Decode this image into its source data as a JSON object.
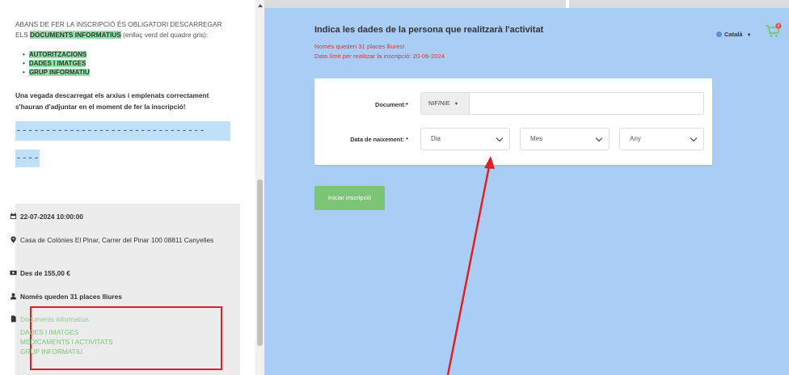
{
  "left_panel": {
    "intro_text_1": "ABANS DE FER LA INSCRIPCIÓ ÉS OBLIGATORI DESCARREGAR ELS ",
    "intro_highlight": "DOCUMENTS INFORMATIUS",
    "intro_text_2": " (enllaç verd del quadre gris):",
    "bullets": [
      "AUTORITZACIONS",
      "DADES I IMATGES",
      "GRUP INFORMATIU"
    ],
    "note": "Una vegada descarregat els arxius i emplenats correctament s'hauran d'adjuntar en el moment de fer la inscripció!",
    "dashes_line_1": "--------------------------------",
    "dashes_line_2": "----",
    "info": {
      "date": "22-07-2024 10:00:00",
      "location": "Casa de Colònies El Pinar, Carrer del Pinar 100 08811 Canyelles",
      "price": "Des de 155,00 €",
      "places": "Només queden 31 places lliures",
      "documents_title": "Documents informatius",
      "documents": [
        "DADES I IMATGES",
        "MEDICAMENTS I ACTIVITATS",
        "GRUP INFORMATIU"
      ]
    }
  },
  "main": {
    "heading": "Indica les dades de la persona que realitzarà l'activitat",
    "places_notice": "Només queden 31 places lliures!",
    "deadline_notice": "Data límit per realitzar la inscripció: 20-06-2024",
    "language": "Català",
    "cart_count": "0",
    "form": {
      "document_label": "Document:*",
      "document_type": "NIF/NIE",
      "document_value": "",
      "birth_label": "Data de naixement: *",
      "day_placeholder": "Dia",
      "month_placeholder": "Mes",
      "year_placeholder": "Any"
    },
    "start_button": "Iniciar inscripció"
  },
  "colors": {
    "background": "#a9cdf4",
    "accent_green": "#7cc576",
    "highlight_green": "#8fe3a8",
    "alert_red": "#d9363e",
    "annotation_red": "#e02020"
  }
}
